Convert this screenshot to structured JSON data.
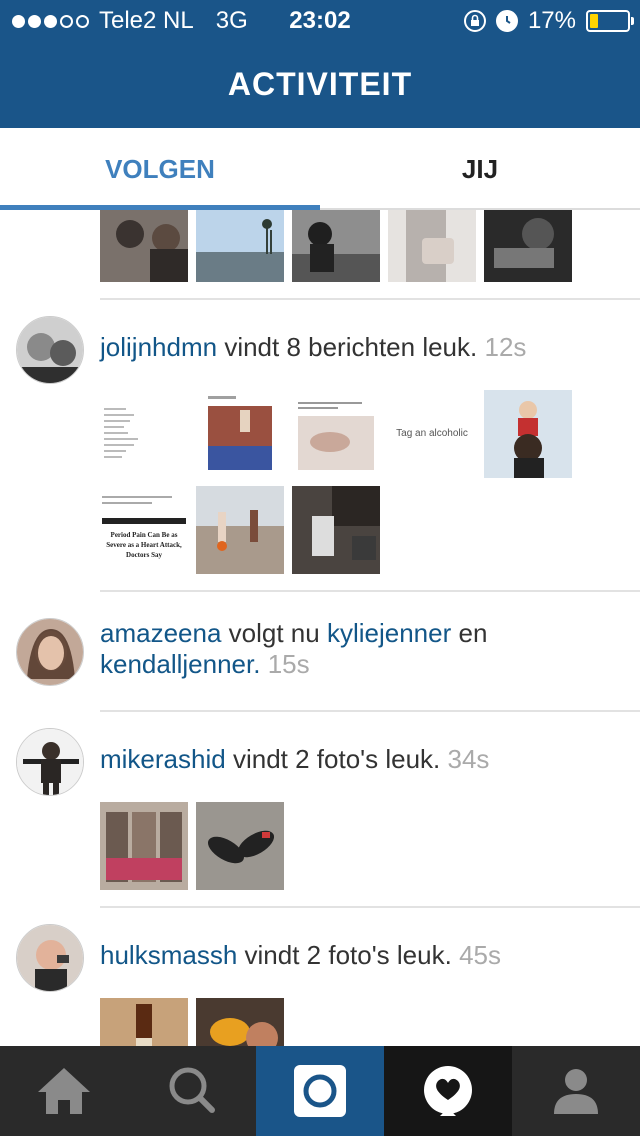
{
  "status_bar": {
    "carrier": "Tele2 NL",
    "network": "3G",
    "time": "23:02",
    "battery": "17%",
    "battery_level": 0.17,
    "signal_bars": 3,
    "signal_total": 5
  },
  "header": {
    "title": "ACTIVITEIT"
  },
  "tabs": [
    {
      "label": "VOLGEN",
      "active": true
    },
    {
      "label": "JIJ",
      "active": false
    }
  ],
  "feed": {
    "entry1": {
      "user": "jolijnhdmn",
      "text": "vindt 8 berichten leuk.",
      "time": "12s"
    },
    "entry2": {
      "user": "amazeena",
      "text": "volgt nu",
      "target1": "kyliejenner",
      "conj": "en",
      "target2": "kendalljenner.",
      "time": "15s"
    },
    "entry3": {
      "user": "mikerashid",
      "text": "vindt 2 foto's leuk.",
      "time": "34s"
    },
    "entry4": {
      "user": "hulksmassh",
      "text": "vindt 2 foto's leuk.",
      "time": "45s"
    },
    "thumb_texts": {
      "alcoholic": "Tag an alcoholic",
      "period_headline": "Period Pain Can Be as Severe as a Heart Attack, Doctors Say"
    }
  },
  "tab_bar": [
    {
      "icon": "home-icon"
    },
    {
      "icon": "search-icon"
    },
    {
      "icon": "camera-icon",
      "active": true
    },
    {
      "icon": "activity-heart-icon"
    },
    {
      "icon": "profile-icon"
    }
  ],
  "colors": {
    "brand": "#1a5589",
    "accent": "#3f80bd",
    "username": "#125688",
    "timestamp": "#aaaaaa"
  }
}
